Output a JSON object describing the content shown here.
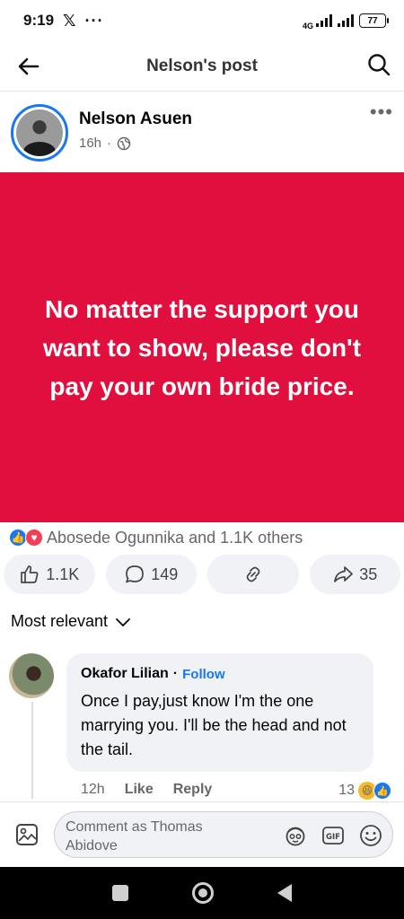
{
  "status_bar": {
    "time": "9:19",
    "x_glyph": "𝕏",
    "dots": "···",
    "network": "4G",
    "battery": "77"
  },
  "header": {
    "title": "Nelson's post"
  },
  "post": {
    "author": "Nelson Asuen",
    "time": "16h",
    "separator": "·",
    "text": "No matter the support you want to show, please don't pay your own bride price.",
    "background_color": "#e00f3d",
    "reactions_text": "Abosede Ogunnika and 1.1K others"
  },
  "actions": {
    "like_count": "1.1K",
    "comment_count": "149",
    "share_count": "35"
  },
  "sort": {
    "label": "Most relevant"
  },
  "comment": {
    "author": "Okafor Lilian",
    "separator": "·",
    "follow": "Follow",
    "text": "Once I pay,just know I'm the one marrying you. I'll be the head and not the tail.",
    "time": "12h",
    "like": "Like",
    "reply": "Reply",
    "reaction_count": "13"
  },
  "composer": {
    "placeholder": "Comment as Thomas Abidove"
  },
  "colors": {
    "accent": "#1877f2",
    "post_bg": "#e00f3d",
    "muted": "#65676b"
  }
}
